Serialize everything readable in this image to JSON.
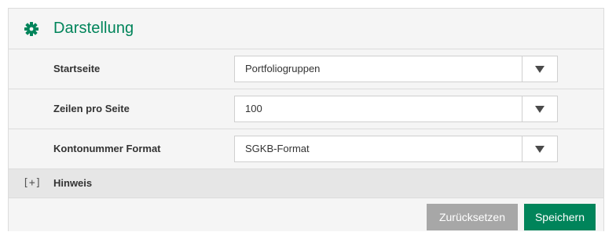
{
  "section": {
    "title": "Darstellung",
    "icon": "gear-icon",
    "accent_color": "#00845a"
  },
  "settings": [
    {
      "label": "Startseite",
      "value": "Portfoliogruppen"
    },
    {
      "label": "Zeilen pro Seite",
      "value": "100"
    },
    {
      "label": "Kontonummer Format",
      "value": "SGKB-Format"
    }
  ],
  "hint": {
    "toggle_symbol": "[+]",
    "label": "Hinweis"
  },
  "buttons": {
    "reset_label": "Zurücksetzen",
    "save_label": "Speichern",
    "reset_color": "#a7a7a7",
    "save_color": "#00845a"
  }
}
